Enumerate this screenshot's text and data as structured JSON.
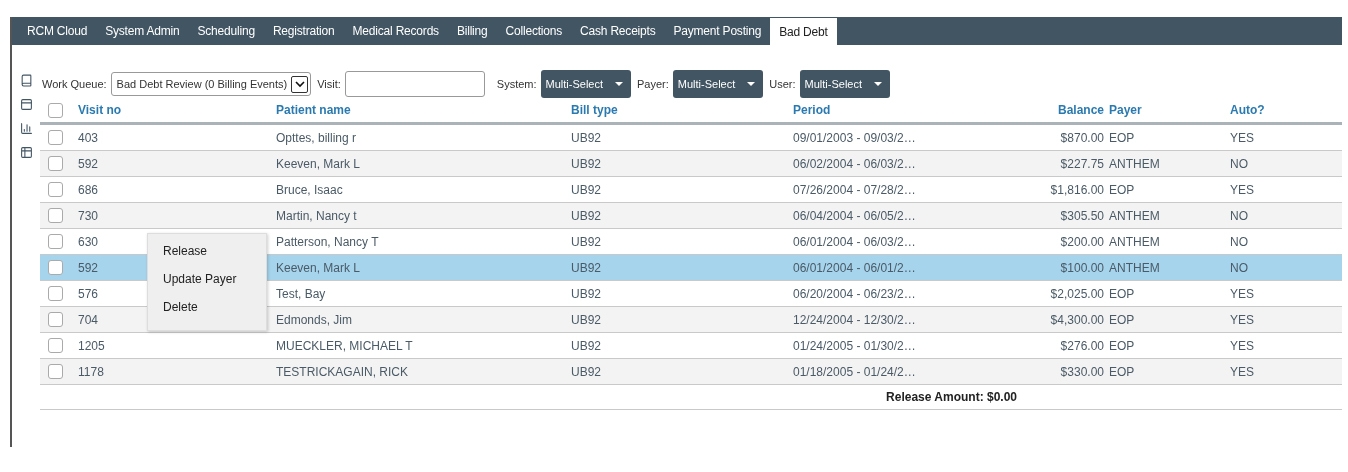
{
  "nav": {
    "tabs": [
      {
        "label": "RCM Cloud",
        "selected": false
      },
      {
        "label": "System Admin",
        "selected": false
      },
      {
        "label": "Scheduling",
        "selected": false
      },
      {
        "label": "Registration",
        "selected": false
      },
      {
        "label": "Medical Records",
        "selected": false
      },
      {
        "label": "Billing",
        "selected": false
      },
      {
        "label": "Collections",
        "selected": false
      },
      {
        "label": "Cash Receipts",
        "selected": false
      },
      {
        "label": "Payment Posting",
        "selected": false
      },
      {
        "label": "Bad Debt",
        "selected": true
      }
    ]
  },
  "filters": {
    "work_queue_label": "Work Queue:",
    "work_queue_value": "Bad Debt Review (0 Billing Events)",
    "visit_label": "Visit:",
    "system_label": "System:",
    "system_value": "Multi-Select",
    "payer_label": "Payer:",
    "payer_value": "Multi-Select",
    "user_label": "User:",
    "user_value": "Multi-Select"
  },
  "table": {
    "columns": [
      "Visit no",
      "Patient name",
      "Bill type",
      "Period",
      "Balance",
      "Payer",
      "Auto?"
    ],
    "header_checked": false,
    "rows": [
      {
        "cells": [
          "403",
          "Opttes, billing r",
          "UB92",
          "09/01/2003 - 09/03/2…",
          "$870.00",
          "EOP",
          "YES"
        ],
        "checked": false,
        "selected": false
      },
      {
        "cells": [
          "592",
          "Keeven, Mark L",
          "UB92",
          "06/02/2004 - 06/03/2…",
          "$227.75",
          "ANTHEM",
          "NO"
        ],
        "checked": false,
        "selected": false
      },
      {
        "cells": [
          "686",
          "Bruce, Isaac",
          "UB92",
          "07/26/2004 - 07/28/2…",
          "$1,816.00",
          "EOP",
          "YES"
        ],
        "checked": false,
        "selected": false
      },
      {
        "cells": [
          "730",
          "Martin, Nancy t",
          "UB92",
          "06/04/2004 - 06/05/2…",
          "$305.50",
          "ANTHEM",
          "NO"
        ],
        "checked": false,
        "selected": false
      },
      {
        "cells": [
          "630",
          "Patterson, Nancy T",
          "UB92",
          "06/01/2004 - 06/03/2…",
          "$200.00",
          "ANTHEM",
          "NO"
        ],
        "checked": false,
        "selected": false
      },
      {
        "cells": [
          "592",
          "Keeven, Mark L",
          "UB92",
          "06/01/2004 - 06/01/2…",
          "$100.00",
          "ANTHEM",
          "NO"
        ],
        "checked": false,
        "selected": true
      },
      {
        "cells": [
          "576",
          "Test, Bay",
          "UB92",
          "06/20/2004 - 06/23/2…",
          "$2,025.00",
          "EOP",
          "YES"
        ],
        "checked": false,
        "selected": false
      },
      {
        "cells": [
          "704",
          "Edmonds, Jim",
          "UB92",
          "12/24/2004 - 12/30/2…",
          "$4,300.00",
          "EOP",
          "YES"
        ],
        "checked": false,
        "selected": false
      },
      {
        "cells": [
          "1205",
          "MUECKLER, MICHAEL T",
          "UB92",
          "01/24/2005 - 01/30/2…",
          "$276.00",
          "EOP",
          "YES"
        ],
        "checked": false,
        "selected": false
      },
      {
        "cells": [
          "1178",
          "TESTRICKAGAIN, RICK",
          "UB92",
          "01/18/2005 - 01/24/2…",
          "$330.00",
          "EOP",
          "YES"
        ],
        "checked": false,
        "selected": false
      }
    ],
    "footer": "Release Amount: $0.00"
  },
  "context_menu": {
    "items": [
      "Release",
      "Update Payer",
      "Delete"
    ]
  }
}
